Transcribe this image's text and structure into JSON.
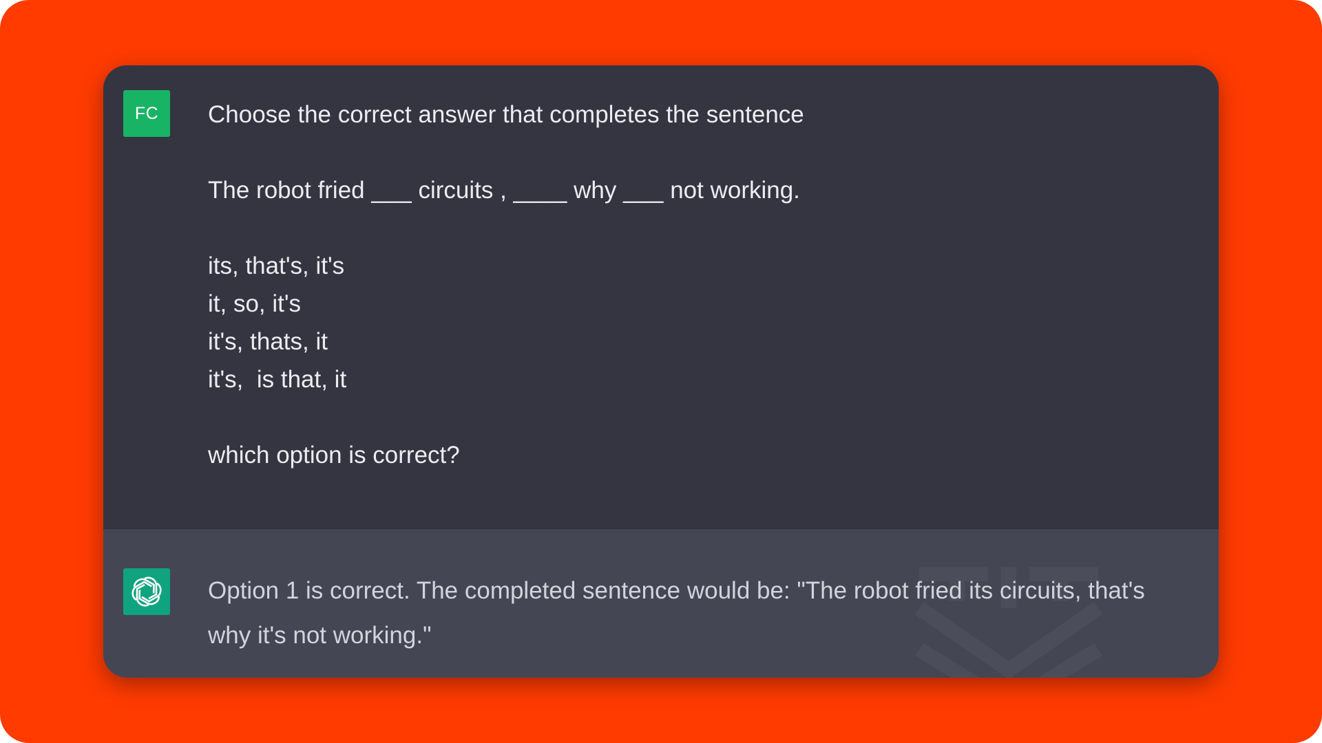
{
  "user_message": {
    "avatar_initials": "FC",
    "avatar_color": "#19b366",
    "prompt": "Choose the correct answer that completes the sentence",
    "sentence": "The robot fried ___ circuits , ____ why ___ not working.",
    "options": [
      "its, that's, it's",
      "it, so, it's",
      "it's, thats, it",
      "it's,  is that, it"
    ],
    "question": "which option is correct?"
  },
  "assistant_message": {
    "avatar_icon": "openai-logo-icon",
    "avatar_color": "#10a37f",
    "response_line1": "Option 1 is correct. The completed sentence would be: \"The robot fried its circuits, that's",
    "response_line2": "why it's not working.\""
  },
  "colors": {
    "background": "#ff3b00",
    "user_panel": "#343541",
    "assistant_panel": "#444654"
  }
}
